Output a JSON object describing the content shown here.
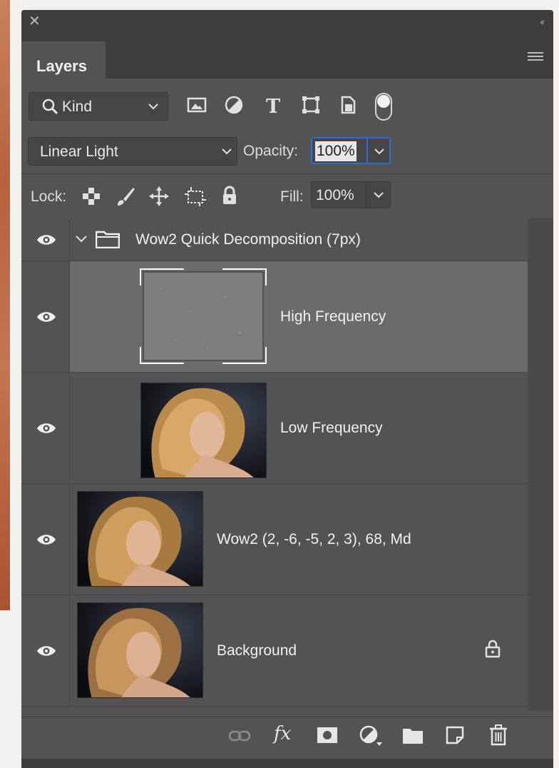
{
  "panel": {
    "tab_label": "Layers",
    "close_glyph": "✕",
    "collapse_glyph": "‹‹"
  },
  "filter": {
    "kind_label": "Kind",
    "icons": [
      "image-filter-icon",
      "adjustment-filter-icon",
      "type-filter-icon",
      "shape-filter-icon",
      "smart-object-filter-icon"
    ],
    "type_glyph": "T",
    "filter_toggle": "on"
  },
  "blend": {
    "mode": "Linear Light",
    "opacity_label": "Opacity:",
    "opacity_value": "100%"
  },
  "lock": {
    "label": "Lock:",
    "fill_label": "Fill:",
    "fill_value": "100%"
  },
  "layers": [
    {
      "name": "Wow2 Quick Decomposition (7px)",
      "type": "group",
      "expanded": true,
      "visible": true
    },
    {
      "name": "High Frequency",
      "type": "layer",
      "selected": true,
      "visible": true
    },
    {
      "name": "Low Frequency",
      "type": "layer",
      "visible": true
    },
    {
      "name": "Wow2 (2, -6, -5, 2, 3), 68, Md",
      "type": "layer",
      "visible": true
    },
    {
      "name": "Background",
      "type": "layer",
      "locked": true,
      "visible": true
    }
  ],
  "bottom_bar": {
    "fx_label": "fx",
    "icons": [
      "link-layers-icon",
      "fx-icon",
      "add-mask-icon",
      "new-adjustment-icon",
      "new-group-icon",
      "new-layer-icon",
      "delete-layer-icon"
    ]
  },
  "colors": {
    "panel_bg": "#535353",
    "selected_row": "#6b6b6b",
    "focus_blue": "#2b6ed6"
  }
}
